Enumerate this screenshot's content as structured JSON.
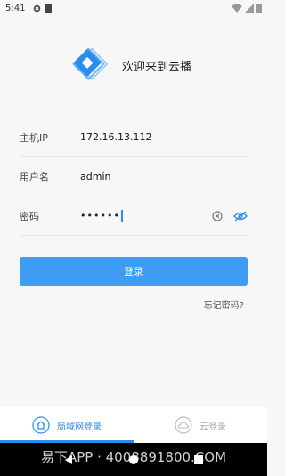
{
  "status": {
    "time": "5:41"
  },
  "app": {
    "title": "欢迎来到云播"
  },
  "form": {
    "host_label": "主机IP",
    "host_value": "172.16.13.112",
    "user_label": "用户名",
    "user_value": "admin",
    "password_label": "密码",
    "password_mask": "••••••"
  },
  "login_button": "登录",
  "forgot_password": "忘记密码?",
  "tabs": [
    {
      "label": "局域网登录",
      "icon": "home-icon",
      "active": true
    },
    {
      "label": "云登录",
      "icon": "cloud-icon",
      "active": false
    }
  ],
  "watermark": "易下APP · 4008891800.COM",
  "colors": {
    "accent": "#3f9cf5",
    "inactive": "#aaaaaa"
  }
}
